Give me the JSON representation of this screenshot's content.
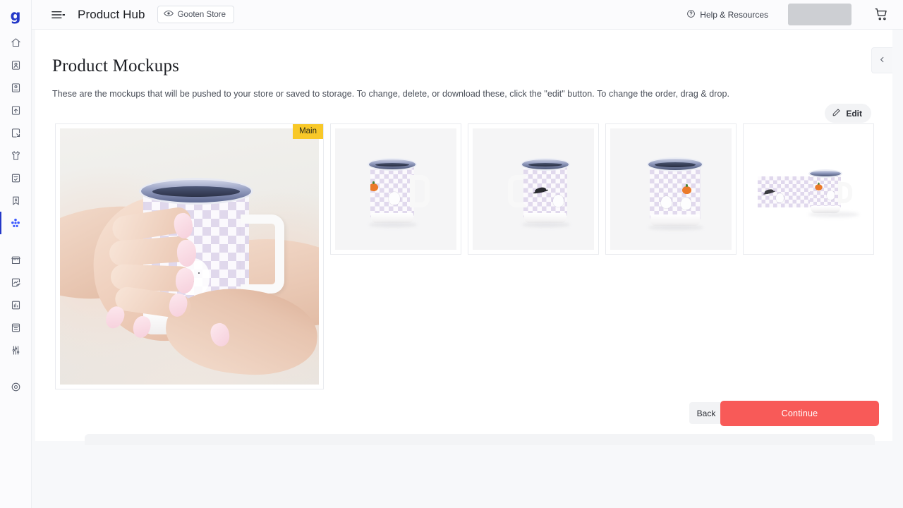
{
  "app": {
    "logo_text": "g",
    "title": "Product Hub",
    "store_pill": {
      "label": "Gooten Store",
      "icon": "eye-icon"
    },
    "menu_icon": "hamburger-menu-icon",
    "help": {
      "label": "Help & Resources",
      "icon": "question-circle-icon"
    },
    "account_placeholder": "",
    "cart_icon": "shopping-cart-icon"
  },
  "sidebar": {
    "items": [
      {
        "name": "home",
        "icon": "home-icon",
        "active": false
      },
      {
        "name": "orders",
        "icon": "person-card-icon",
        "active": false
      },
      {
        "name": "customers",
        "icon": "person-card-badge-icon",
        "active": false
      },
      {
        "name": "upload",
        "icon": "upload-box-icon",
        "active": false
      },
      {
        "name": "import",
        "icon": "import-box-icon",
        "active": false
      },
      {
        "name": "products",
        "icon": "tshirt-icon",
        "active": false
      },
      {
        "name": "approvals",
        "icon": "document-check-icon",
        "active": false
      },
      {
        "name": "saved",
        "icon": "bookmark-s-icon",
        "active": false
      },
      {
        "name": "product-hub",
        "icon": "hub-network-icon",
        "active": true
      },
      {
        "name": "storefront",
        "icon": "storefront-icon",
        "active": false
      },
      {
        "name": "analytics",
        "icon": "chart-edit-icon",
        "active": false
      },
      {
        "name": "reports",
        "icon": "report-icon",
        "active": false
      },
      {
        "name": "archive",
        "icon": "archive-box-icon",
        "active": false
      },
      {
        "name": "settings",
        "icon": "sliders-icon",
        "active": false
      },
      {
        "name": "support",
        "icon": "target-icon",
        "active": false
      }
    ]
  },
  "page": {
    "title": "Product Mockups",
    "description": "These are the mockups that will be pushed to your store or saved to storage. To change, delete, or download these, click the \"edit\" button. To change the order, drag & drop.",
    "edit_button": {
      "label": "Edit",
      "icon": "pencil-icon"
    },
    "collapse_icon": "chevron-left-icon"
  },
  "mockups": {
    "main_badge": "Main",
    "items": [
      {
        "name": "mockup-lifestyle-hands-holding-mug",
        "type": "main",
        "badge": "Main"
      },
      {
        "name": "mockup-mug-front-left",
        "type": "thumb"
      },
      {
        "name": "mockup-mug-front-right",
        "type": "thumb"
      },
      {
        "name": "mockup-mug-straight-on",
        "type": "thumb"
      },
      {
        "name": "mockup-design-wrap-flat",
        "type": "thumb"
      }
    ]
  },
  "footer": {
    "back_label": "Back",
    "continue_label": "Continue"
  },
  "colors": {
    "brand_blue": "#2438c8",
    "accent_coral": "#f85a58",
    "badge_yellow": "#f8c828",
    "checker_purple": "#ded5ec"
  }
}
